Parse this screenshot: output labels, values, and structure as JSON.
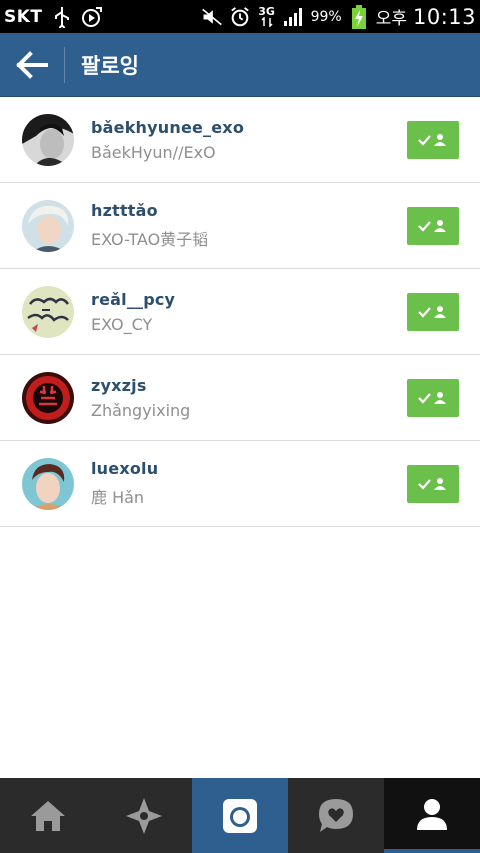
{
  "status_bar": {
    "carrier": "SKT",
    "network": "3G",
    "battery_percent": "99%",
    "ampm": "오후",
    "time": "10:13",
    "icons": [
      "usb-icon",
      "media-icon",
      "mute-icon",
      "alarm-icon",
      "signal-icon",
      "battery-charging-icon"
    ]
  },
  "header": {
    "title": "팔로잉",
    "back_icon": "back-arrow-icon",
    "color": "#2f5f8f"
  },
  "following": [
    {
      "username": "bǎekhyunee_exo",
      "full_name": "BǎekHyun//ExO"
    },
    {
      "username": "hztttǎo",
      "full_name": "EXO-TAO黄子韬"
    },
    {
      "username": "reǎl__pcy",
      "full_name": "EXO_CY"
    },
    {
      "username": "zyxzjs",
      "full_name": "Zhǎngyixing"
    },
    {
      "username": "luexolu",
      "full_name": "鹿 Hǎn"
    }
  ],
  "follow_button": {
    "icon": "following-check-user-icon",
    "color": "#6bbf4b"
  },
  "bottom_nav": {
    "items": [
      "home-icon",
      "explore-icon",
      "camera-icon",
      "news-icon",
      "profile-icon"
    ],
    "active": "profile-icon"
  }
}
